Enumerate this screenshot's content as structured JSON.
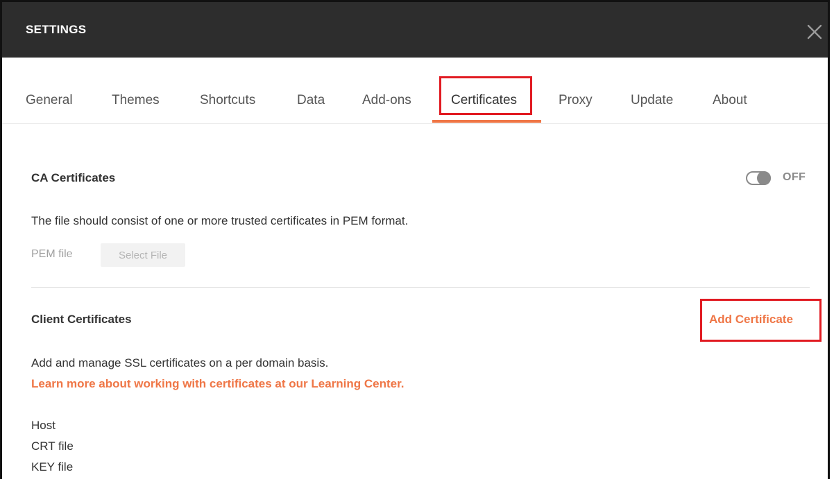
{
  "window": {
    "title": "SETTINGS",
    "close_icon": "close-icon"
  },
  "tabs": [
    {
      "label": "General"
    },
    {
      "label": "Themes"
    },
    {
      "label": "Shortcuts"
    },
    {
      "label": "Data"
    },
    {
      "label": "Add-ons"
    },
    {
      "label": "Certificates",
      "active": true
    },
    {
      "label": "Proxy"
    },
    {
      "label": "Update"
    },
    {
      "label": "About"
    }
  ],
  "ca_certificates": {
    "title": "CA Certificates",
    "toggle_state": "OFF",
    "description": "The file should consist of one or more trusted certificates in PEM format.",
    "pem_label": "PEM file",
    "select_file_label": "Select File"
  },
  "client_certificates": {
    "title": "Client Certificates",
    "add_label": "Add Certificate",
    "description": "Add and manage SSL certificates on a per domain basis.",
    "learn_more": "Learn more about working with certificates at our Learning Center.",
    "fields": [
      "Host",
      "CRT file",
      "KEY file"
    ]
  },
  "colors": {
    "accent": "#ef7646",
    "highlight": "#e11b22",
    "titlebar": "#2d2d2d"
  }
}
